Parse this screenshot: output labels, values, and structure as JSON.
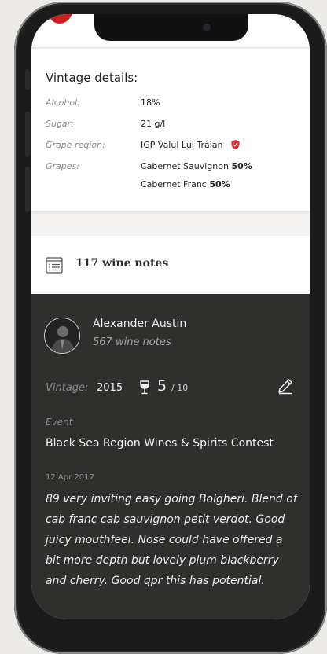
{
  "vintage": {
    "title": "Vintage details:",
    "rows": [
      {
        "label": "Alcohol:",
        "value": "18%"
      },
      {
        "label": "Sugar:",
        "value": "21 g/l"
      },
      {
        "label": "Grape region:",
        "value": "IGP Valul Lui Traian"
      },
      {
        "label": "Grapes:",
        "value": "Cabernet Sauvignon",
        "value_pct": "50%"
      },
      {
        "label": "",
        "value": "Cabernet Franc",
        "value_pct": "50%"
      }
    ]
  },
  "notes_bar": {
    "count_label": "117 wine notes"
  },
  "note_card": {
    "author": "Alexander Austin",
    "author_notes": "567 wine notes",
    "vintage_label": "Vintage:",
    "vintage_value": "2015",
    "score": "5",
    "score_max": "/ 10",
    "event_label": "Event",
    "event_value": "Black Sea Region Wines & Spirits Contest",
    "date": "12 Apr 2017",
    "text": "89 very inviting easy going Bolgheri. Blend of cab franc cab sauvignon petit verdot. Good juicy mouthfeel. Nose could have offered a bit more depth but lovely plum blackberry and cherry. Good qpr this has potential."
  },
  "colors": {
    "accent_red": "#c81e1e",
    "dark_panel": "#2f2f2e"
  },
  "icons": {
    "region_badge": "shield-check-icon",
    "notes": "notes-list-icon",
    "score": "wine-glass-icon",
    "edit": "pencil-icon"
  }
}
